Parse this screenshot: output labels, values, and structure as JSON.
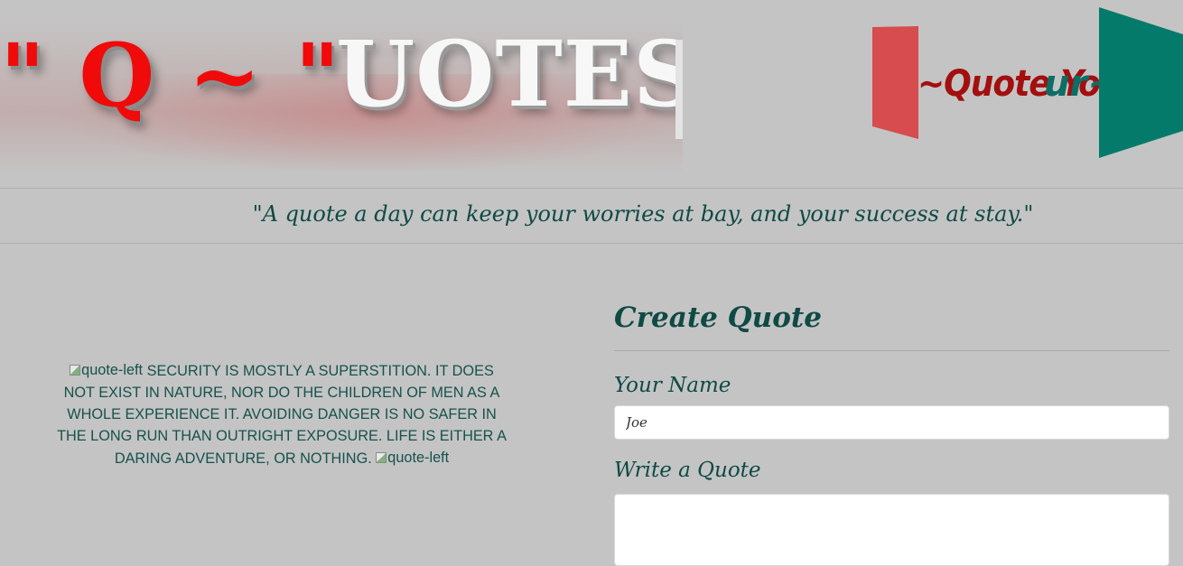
{
  "header": {
    "logo_prefix": "\" Q ~ \"",
    "logo_suffix": "UOTES",
    "cube_text_red": "~Quote Yo",
    "cube_text_teal": "ur~"
  },
  "tagline": "\"A quote a day can keep your worries at bay, and your success at stay.\"",
  "featured_quote": {
    "left_img_alt": "quote-left",
    "text": "SECURITY IS MOSTLY A SUPERSTITION. IT DOES NOT EXIST IN NATURE, NOR DO THE CHILDREN OF MEN AS A WHOLE EXPERIENCE IT. AVOIDING DANGER IS NO SAFER IN THE LONG RUN THAN OUTRIGHT EXPOSURE. LIFE IS EITHER A DARING ADVENTURE, OR NOTHING.",
    "right_img_alt": "quote-left"
  },
  "form": {
    "title": "Create Quote",
    "name_label": "Your Name",
    "name_value": "Joe",
    "quote_label": "Write a Quote",
    "quote_value": ""
  },
  "colors": {
    "background": "#c4c4c4",
    "logo_red": "#f00a0a",
    "logo_white": "#f7f7f7",
    "teal_text": "#0f4a44",
    "cube_red": "#d64c4f",
    "cube_teal": "#047a6b"
  }
}
